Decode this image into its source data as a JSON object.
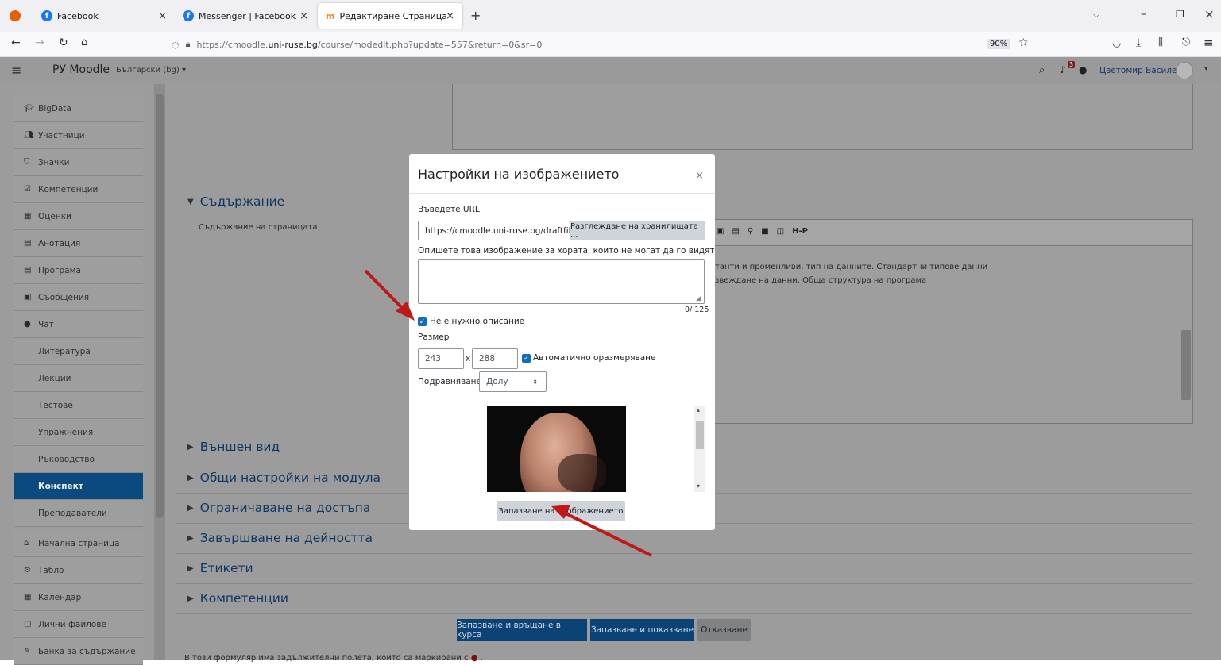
{
  "browser": {
    "tabs": [
      {
        "label": "Facebook",
        "icon": "facebook-icon"
      },
      {
        "label": "Messenger | Facebook",
        "icon": "facebook-icon"
      },
      {
        "label": "Редактиране Страница",
        "icon": "moodle-icon"
      }
    ],
    "url_prefix": "https://cmoodle.",
    "url_domain": "uni-ruse.bg",
    "url_path": "/course/modedit.php?update=557&return=0&sr=0",
    "zoom": "90%"
  },
  "moodle": {
    "site_name": "РУ Moodle",
    "language": "Български (bg) ▾",
    "user_name": "Цветомир Василев",
    "notification_count": "3"
  },
  "drawer": {
    "items": [
      {
        "label": "BigData",
        "icon": "graduation-cap-icon",
        "sub": false
      },
      {
        "label": "Участници",
        "icon": "users-icon",
        "sub": false
      },
      {
        "label": "Значки",
        "icon": "shield-icon",
        "sub": false
      },
      {
        "label": "Компетенции",
        "icon": "checkbox-icon",
        "sub": false
      },
      {
        "label": "Оценки",
        "icon": "table-icon",
        "sub": false
      },
      {
        "label": "Анотация",
        "icon": "page-icon",
        "sub": false
      },
      {
        "label": "Програма",
        "icon": "page-icon",
        "sub": false
      },
      {
        "label": "Съобщения",
        "icon": "forum-icon",
        "sub": false
      },
      {
        "label": "Чат",
        "icon": "chat-icon",
        "sub": false
      },
      {
        "label": "Литература",
        "icon": "",
        "sub": true
      },
      {
        "label": "Лекции",
        "icon": "",
        "sub": true
      },
      {
        "label": "Тестове",
        "icon": "",
        "sub": true
      },
      {
        "label": "Упражнения",
        "icon": "",
        "sub": true
      },
      {
        "label": "Ръководство",
        "icon": "",
        "sub": true
      },
      {
        "label": "Конспект",
        "icon": "",
        "sub": true,
        "active": true
      },
      {
        "label": "Преподаватели",
        "icon": "",
        "sub": true
      },
      {
        "label": "Начална страница",
        "icon": "home-icon",
        "sub": false
      },
      {
        "label": "Табло",
        "icon": "dashboard-icon",
        "sub": false
      },
      {
        "label": "Календар",
        "icon": "calendar-icon",
        "sub": false
      },
      {
        "label": "Лични файлове",
        "icon": "file-icon",
        "sub": false
      },
      {
        "label": "Банка за съдържание",
        "icon": "brush-icon",
        "sub": false
      }
    ]
  },
  "form": {
    "content_section": "Съдържание",
    "content_label": "Съдържание на страницата",
    "editor_text_1": "танти и променливи, тип на данните. Стандартни типове данни",
    "editor_text_2": "звеждане на данни. Обща структура на програма",
    "sections": [
      "Външен вид",
      "Общи настройки на модула",
      "Ограничаване на достъпа",
      "Завършване на дейността",
      "Етикети",
      "Компетенции"
    ],
    "save_return": "Запазване и връщане в курса",
    "save_show": "Запазване и показване",
    "cancel": "Отказване",
    "required_note": "В този формуляр има задължителни полета, които са маркирани с"
  },
  "modal": {
    "title": "Настройки на изображението",
    "url_label": "Въведете URL",
    "url_value": "https://cmoodle.uni-ruse.bg/draftfile.",
    "browse_button": "Разглеждане на хранилищата ...",
    "alt_label": "Опишете това изображение за хората, които не могат да го видят",
    "alt_counter": "0/ 125",
    "no_desc_label": "Не е нужно описание",
    "size_label": "Размер",
    "width": "243",
    "height": "288",
    "size_sep": "x",
    "auto_size_label": "Автоматично оразмеряване",
    "align_label": "Подравняване",
    "align_value": "Долу",
    "save_button": "Запазване на изображението"
  }
}
